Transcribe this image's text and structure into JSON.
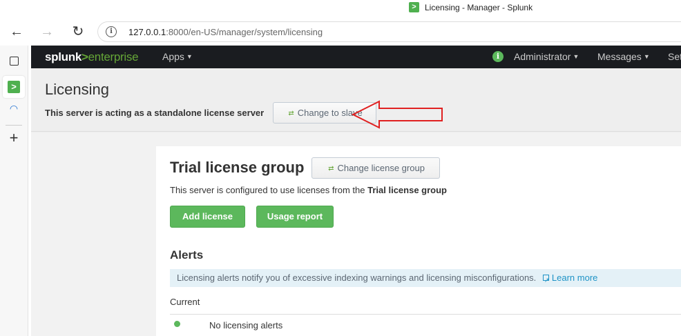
{
  "browser": {
    "tab_title": "Licensing - Manager - Splunk",
    "url_host": "127.0.0.1",
    "url_rest": ":8000/en-US/manager/system/licensing"
  },
  "splunk_nav": {
    "logo_brand": "splunk",
    "logo_gt": ">",
    "logo_product": "enterprise",
    "apps": "Apps",
    "administrator": "Administrator",
    "messages": "Messages",
    "settings": "Set"
  },
  "header": {
    "title": "Licensing",
    "server_status": "This server is acting as a standalone license server",
    "change_button": "Change to slave"
  },
  "license_group": {
    "title": "Trial license group",
    "change_button": "Change license group",
    "desc_prefix": "This server is configured to use licenses from the ",
    "desc_group": "Trial license group",
    "add_license": "Add license",
    "usage_report": "Usage report"
  },
  "alerts": {
    "title": "Alerts",
    "info": "Licensing alerts notify you of excessive indexing warnings and licensing misconfigurations.",
    "learn_more": "Learn more",
    "current_label": "Current",
    "no_alerts": "No licensing alerts"
  },
  "colors": {
    "accent_green": "#5cb85c",
    "annotation_red": "#e02020",
    "nav_bg": "#1a1c20"
  }
}
